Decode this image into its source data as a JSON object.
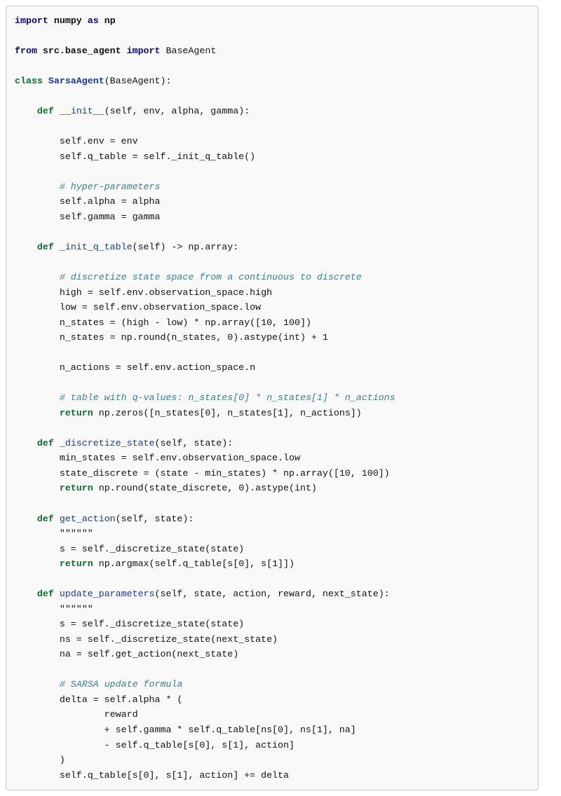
{
  "code": {
    "l1a": "import",
    "l1b": "numpy",
    "l1c": "as",
    "l1d": "np",
    "l3a": "from",
    "l3b": "src.base_agent",
    "l3c": "import",
    "l3d": "BaseAgent",
    "l5a": "class",
    "l5b": "SarsaAgent",
    "l5c": "(BaseAgent):",
    "l7a": "def",
    "l7b": "__init__",
    "l7c": "(self, env, alpha, gamma):",
    "l9": "self.env = env",
    "l10": "self.q_table = self._init_q_table()",
    "l12c": "# hyper-parameters",
    "l13": "self.alpha = alpha",
    "l14": "self.gamma = gamma",
    "l16a": "def",
    "l16b": "_init_q_table",
    "l16c": "(self) -> np.array:",
    "l18c": "# discretize state space from a continuous to discrete",
    "l19": "high = self.env.observation_space.high",
    "l20": "low = self.env.observation_space.low",
    "l21": "n_states = (high - low) * np.array([10, 100])",
    "l22": "n_states = np.round(n_states, 0).astype(int) + 1",
    "l24": "n_actions = self.env.action_space.n",
    "l26c": "# table with q-values: n_states[0] * n_states[1] * n_actions",
    "l27a": "return",
    "l27b": "np.zeros([n_states[0], n_states[1], n_actions])",
    "l29a": "def",
    "l29b": "_discretize_state",
    "l29c": "(self, state):",
    "l30": "min_states = self.env.observation_space.low",
    "l31": "state_discrete = (state - min_states) * np.array([10, 100])",
    "l32a": "return",
    "l32b": "np.round(state_discrete, 0).astype(int)",
    "l34a": "def",
    "l34b": "get_action",
    "l34c": "(self, state):",
    "l35": "\"\"\"\"\"\"",
    "l36": "s = self._discretize_state(state)",
    "l37a": "return",
    "l37b": "np.argmax(self.q_table[s[0], s[1]])",
    "l39a": "def",
    "l39b": "update_parameters",
    "l39c": "(self, state, action, reward, next_state):",
    "l40": "\"\"\"\"\"\"",
    "l41": "s = self._discretize_state(state)",
    "l42": "ns = self._discretize_state(next_state)",
    "l43": "na = self.get_action(next_state)",
    "l45c": "# SARSA update formula",
    "l46": "delta = self.alpha * (",
    "l47": "reward",
    "l48": "+ self.gamma * self.q_table[ns[0], ns[1], na]",
    "l49": "- self.q_table[s[0], s[1], action]",
    "l50": ")",
    "l51": "self.q_table[s[0], s[1], action] += delta"
  }
}
